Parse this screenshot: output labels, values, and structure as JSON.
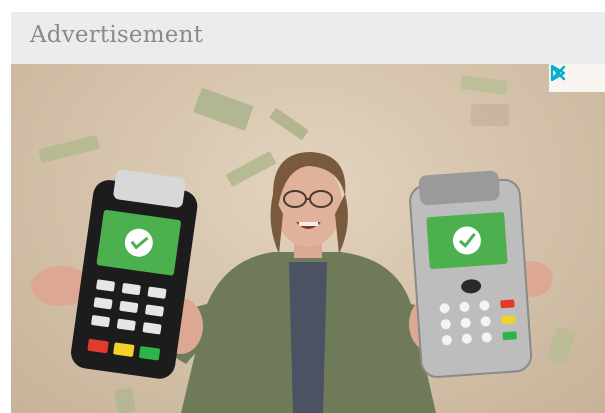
{
  "advertisement": {
    "label": "Advertisement",
    "accent_color": "#00aecd",
    "adchoices_icon": "play-triangle-icon",
    "close_icon": "close-icon"
  }
}
